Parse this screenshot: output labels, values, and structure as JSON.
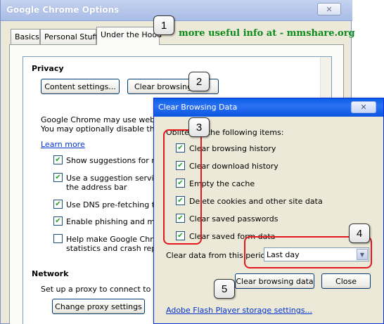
{
  "options_window": {
    "title": "Google Chrome Options",
    "close_glyph": "✕",
    "tabs": [
      {
        "label": "Basics",
        "active": false
      },
      {
        "label": "Personal Stuff",
        "active": false
      },
      {
        "label": "Under the Hood",
        "active": true
      }
    ],
    "privacy": {
      "heading": "Privacy",
      "content_settings_label": "Content settings...",
      "clear_browsing_label": "Clear browsing d",
      "description_line1": "Google Chrome may use web serv",
      "description_line2": "You may optionally disable these s",
      "learn_more": "Learn more",
      "checkboxes": [
        {
          "line1": "Show suggestions for navi",
          "line2": "",
          "checked": true
        },
        {
          "line1": "Use a suggestion service t",
          "line2": "the address bar",
          "checked": true
        },
        {
          "line1": "Use DNS pre-fetching to in",
          "line2": "",
          "checked": true
        },
        {
          "line1": "Enable phishing and malwa",
          "line2": "",
          "checked": true
        },
        {
          "line1": "Help make Google Chrome",
          "line2": "statistics and crash report",
          "checked": false
        }
      ]
    },
    "network": {
      "heading": "Network",
      "description": "Set up a proxy to connect to the n",
      "proxy_button_label": "Change proxy settings"
    }
  },
  "watermark": "more useful info at - mmshare.org",
  "clear_dialog": {
    "title": "Clear Browsing Data",
    "close_glyph": "✕",
    "intro": "Obliterate the following items:",
    "items": [
      {
        "label": "Clear browsing history",
        "checked": true
      },
      {
        "label": "Clear download history",
        "checked": true
      },
      {
        "label": "Empty the cache",
        "checked": true
      },
      {
        "label": "Delete cookies and other site data",
        "checked": true
      },
      {
        "label": "Clear saved passwords",
        "checked": true
      },
      {
        "label": "Clear saved form data",
        "checked": true
      }
    ],
    "period_label": "Clear data from this period:",
    "period_value": "Last day",
    "clear_button_label": "Clear browsing data",
    "close_button_label": "Close",
    "flash_link": "Adobe Flash Player storage settings..."
  },
  "check_glyph": "✔",
  "dropdown_glyph": "▼",
  "callouts": [
    "1",
    "2",
    "3",
    "4",
    "5"
  ],
  "colors": {
    "highlight_red": "#e4171d",
    "watermark_green": "#0b8a1c",
    "dialog_title_blue": "#0a5ee8",
    "link_blue": "#0033cc"
  }
}
